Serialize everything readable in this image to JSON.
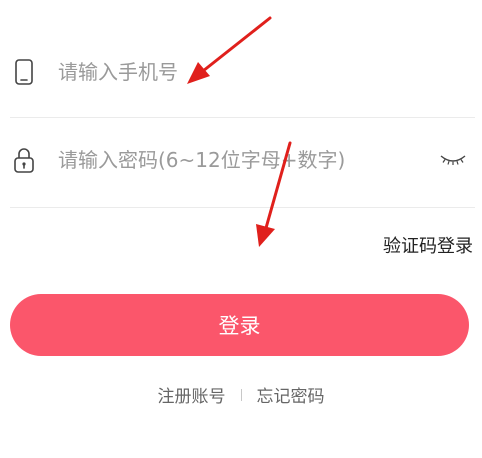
{
  "form": {
    "phone_placeholder": "请输入手机号",
    "password_placeholder": "请输入密码(6~12位字母+数字)",
    "phone_icon": "phone-icon",
    "lock_icon": "lock-icon",
    "eye_icon": "eye-closed-icon"
  },
  "links": {
    "sms_login": "验证码登录",
    "register": "注册账号",
    "forgot_password": "忘记密码"
  },
  "actions": {
    "login_label": "登录"
  },
  "colors": {
    "accent": "#fb566b",
    "annotation_arrow": "#e0201c"
  }
}
